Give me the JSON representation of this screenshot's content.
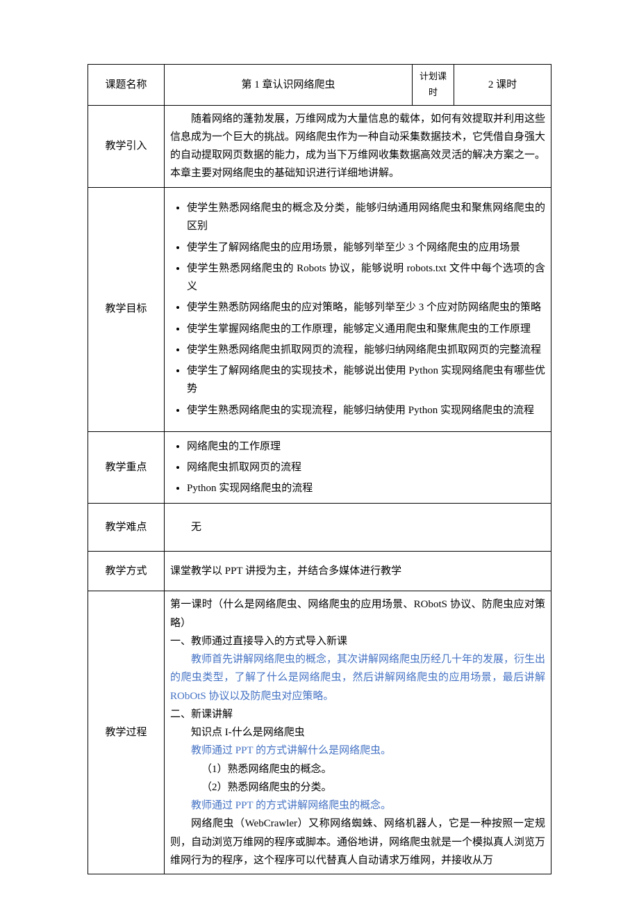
{
  "header": {
    "topic_label": "课题名称",
    "topic_value": "第 1 章认识网络爬虫",
    "plan_label": "计划课时",
    "hours_value": "2 课时"
  },
  "intro": {
    "label": "教学引入",
    "text": "随着网络的蓬勃发展，万维网成为大量信息的载体，如何有效提取并利用这些信息成为一个巨大的挑战。网络爬虫作为一种自动采集数据技术，它凭借自身强大的自动提取网页数据的能力，成为当下万维网收集数据高效灵活的解决方案之一。本章主要对网络爬虫的基础知识进行详细地讲解。"
  },
  "goals": {
    "label": "教学目标",
    "items": [
      "使学生熟悉网络爬虫的概念及分类，能够归纳通用网络爬虫和聚焦网络爬虫的区别",
      "使学生了解网络爬虫的应用场景，能够列举至少 3 个网络爬虫的应用场景",
      "使学生熟悉网络爬虫的 Robots 协议，能够说明 robots.txt 文件中每个选项的含义",
      "使学生熟悉防网络爬虫的应对策略，能够列举至少 3 个应对防网络爬虫的策略",
      "使学生掌握网络爬虫的工作原理，能够定义通用爬虫和聚焦爬虫的工作原理",
      "使学生熟悉网络爬虫抓取网页的流程，能够归纳网络爬虫抓取网页的完整流程",
      "使学生了解网络爬虫的实现技术，能够说出使用 Python 实现网络爬虫有哪些优势",
      "使学生熟悉网络爬虫的实现流程，能够归纳使用 Python 实现网络爬虫的流程"
    ]
  },
  "key": {
    "label": "教学重点",
    "items": [
      "网络爬虫的工作原理",
      "网络爬虫抓取网页的流程",
      "Python 实现网络爬虫的流程"
    ]
  },
  "difficulty": {
    "label": "教学难点",
    "value": "无"
  },
  "method": {
    "label": "教学方式",
    "value": "课堂教学以 PPT 讲授为主，并结合多媒体进行教学"
  },
  "process": {
    "label": "教学过程",
    "p1": "第一课时（什么是网络爬虫、网络爬虫的应用场景、RObotS 协议、防爬虫应对策略）",
    "p2": "一、教师通过直接导入的方式导入新课",
    "p3_blue": "教师首先讲解网络爬虫的概念，其次讲解网络爬虫历经几十年的发展，衍生出的爬虫类型，了解了什么是网络爬虫，然后讲解网络爬虫的应用场景，最后讲解 RObOtS 协议以及防爬虫对应策略。",
    "p4": "二、新课讲解",
    "p5": "知识点 I-什么是网络爬虫",
    "p6_blue": "教师通过 PPT 的方式讲解什么是网络爬虫。",
    "p7": "（1）熟悉网络爬虫的概念。",
    "p8": "（2）熟悉网络爬虫的分类。",
    "p9_blue": "教师通过 PPT 的方式讲解网络爬虫的概念。",
    "p10": "网络爬虫（WebCrawler）又称网络蜘蛛、网络机器人，它是一种按照一定规则，自动浏览万维网的程序或脚本。通俗地讲，网络爬虫就是一个模拟真人浏览万维网行为的程序，这个程序可以代替真人自动请求万维网，并接收从万"
  }
}
